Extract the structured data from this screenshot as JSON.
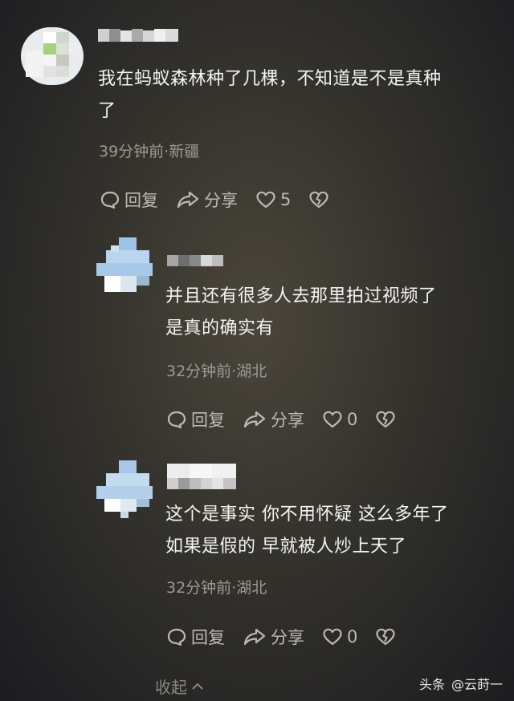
{
  "comments": [
    {
      "text": "我在蚂蚁森林种了几棵，不知道是不是真种了",
      "text_line1": "我在蚂蚁森林种了几棵，不知道是不是真种",
      "text_line2": "了",
      "meta": "39分钟前·新疆",
      "reply_label": "回复",
      "share_label": "分享",
      "likes": "5"
    },
    {
      "text_line1": "并且还有很多人去那里拍过视频了",
      "text_line2": "是真的确实有",
      "meta": "32分钟前·湖北",
      "reply_label": "回复",
      "share_label": "分享",
      "likes": "0"
    },
    {
      "text_line1": "这个是事实 你不用怀疑 这么多年了",
      "text_line2": "如果是假的 早就被人炒上天了",
      "meta": "32分钟前·湖北",
      "reply_label": "回复",
      "share_label": "分享",
      "likes": "0"
    }
  ],
  "collapse_label": "收起",
  "watermark": {
    "brand": "头条",
    "handle": "@云莳一"
  },
  "colors": {
    "text": "#f4f4f4",
    "meta": "#9d9a93",
    "action": "#bdbab3"
  },
  "icons": [
    "comment-icon",
    "share-arrow-icon",
    "heart-icon",
    "broken-heart-icon",
    "chevron-up-icon"
  ]
}
